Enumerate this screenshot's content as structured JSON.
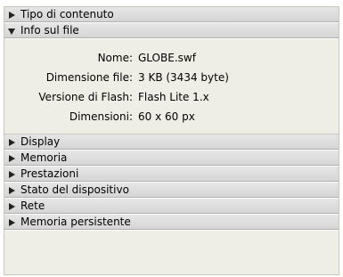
{
  "sections_top": [
    {
      "label": "Tipo di contenuto",
      "expanded": false
    },
    {
      "label": "Info sul file",
      "expanded": true
    }
  ],
  "file_info": [
    {
      "label": "Nome:",
      "value": "GLOBE.swf"
    },
    {
      "label": "Dimensione file:",
      "value": "3 KB (3434 byte)"
    },
    {
      "label": "Versione di Flash:",
      "value": "Flash Lite 1.x"
    },
    {
      "label": "Dimensioni:",
      "value": "60 x 60 px"
    }
  ],
  "sections_bottom": [
    {
      "label": "Display",
      "expanded": false
    },
    {
      "label": "Memoria",
      "expanded": false
    },
    {
      "label": "Prestazioni",
      "expanded": false
    },
    {
      "label": "Stato del dispositivo",
      "expanded": false
    },
    {
      "label": "Rete",
      "expanded": false
    },
    {
      "label": "Memoria persistente",
      "expanded": false
    }
  ]
}
